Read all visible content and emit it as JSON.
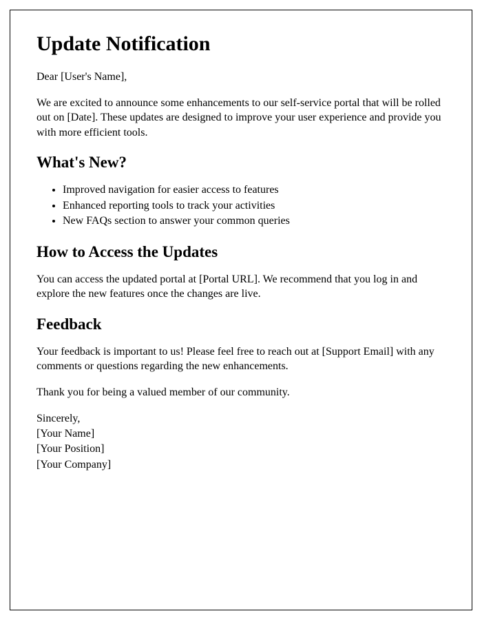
{
  "title": "Update Notification",
  "salutation": "Dear [User's Name],",
  "intro": "We are excited to announce some enhancements to our self-service portal that will be rolled out on [Date]. These updates are designed to improve your user experience and provide you with more efficient tools.",
  "section_whatsnew": {
    "heading": "What's New?",
    "items": [
      "Improved navigation for easier access to features",
      "Enhanced reporting tools to track your activities",
      "New FAQs section to answer your common queries"
    ]
  },
  "section_access": {
    "heading": "How to Access the Updates",
    "body": "You can access the updated portal at [Portal URL]. We recommend that you log in and explore the new features once the changes are live."
  },
  "section_feedback": {
    "heading": "Feedback",
    "body": "Your feedback is important to us! Please feel free to reach out at [Support Email] with any comments or questions regarding the new enhancements."
  },
  "thank_you": "Thank you for being a valued member of our community.",
  "closing": "Sincerely,",
  "signature": {
    "name": "[Your Name]",
    "position": "[Your Position]",
    "company": "[Your Company]"
  }
}
